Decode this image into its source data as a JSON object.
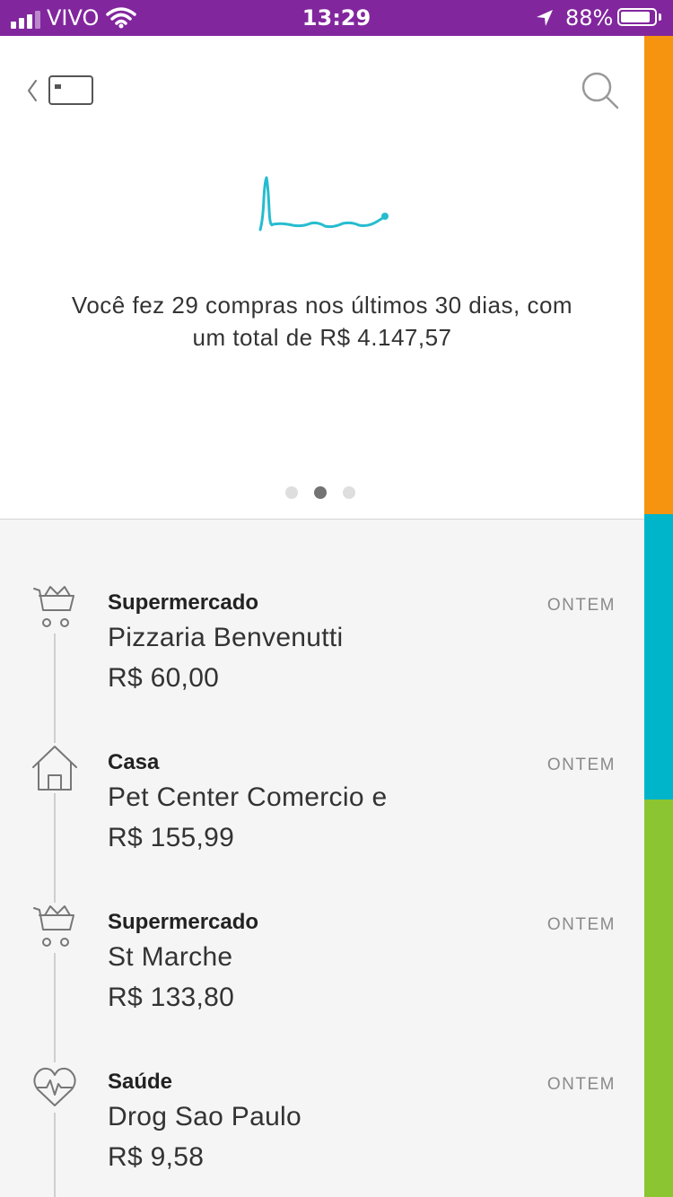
{
  "status_bar": {
    "carrier": "VIVO",
    "time": "13:29",
    "battery": "88%",
    "battery_level": 0.88
  },
  "colors": {
    "status_bar_bg": "#82269e",
    "accent_line": "#26bcd0",
    "strip": [
      "#f7940f",
      "#00b5c9",
      "#8bc532"
    ]
  },
  "header": {
    "back_icon": "chevron-left-icon",
    "card_icon": "credit-card-icon",
    "search_icon": "search-icon"
  },
  "summary": {
    "text": "Você fez 29 compras nos últimos 30 dias, com um total de R$ 4.147,57"
  },
  "pager": {
    "count": 3,
    "active": 1
  },
  "transactions": [
    {
      "icon": "shopping-cart-icon",
      "category": "Supermercado",
      "merchant": "Pizzaria Benvenutti",
      "amount": "R$ 60,00",
      "date": "ONTEM"
    },
    {
      "icon": "house-icon",
      "category": "Casa",
      "merchant": "Pet Center Comercio e",
      "amount": "R$ 155,99",
      "date": "ONTEM"
    },
    {
      "icon": "shopping-cart-icon",
      "category": "Supermercado",
      "merchant": "St Marche",
      "amount": "R$ 133,80",
      "date": "ONTEM"
    },
    {
      "icon": "heart-pulse-icon",
      "category": "Saúde",
      "merchant": "Drog Sao Paulo",
      "amount": "R$ 9,58",
      "date": "ONTEM"
    }
  ]
}
